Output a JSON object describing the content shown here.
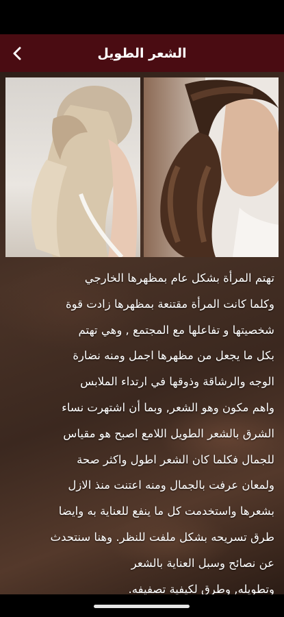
{
  "header": {
    "title": "الشعر الطويل",
    "back_icon": "chevron-left-icon",
    "background_color": "#4a0c12"
  },
  "hero": {
    "images": [
      "blonde-ponytail-photo",
      "braided-brunette-ponytail-photo"
    ]
  },
  "article": {
    "lines": [
      "تهتم المرأة بشكل عام بمظهرها الخارجي",
      "وكلما كانت المرأة مقتنعة بمظهرها زادت قوة",
      "شخصيتها و تفاعلها مع المجتمع , وهي تهتم",
      "بكل ما يجعل من مظهرها اجمل ومنه نضارة",
      "الوجه والرشاقة وذوقها في ارتداء الملابس",
      "واهم مكون وهو الشعر, وبما أن اشتهرت نساء",
      "الشرق بالشعر الطويل اللامع اصبح هو مقياس",
      "للجمال فكلما كان الشعر اطول واكثر صحة",
      "ولمعان عرفت بالجمال ومنه اعتنت منذ الازل",
      "بشعرها واستخدمت كل ما ينفع للعناية به وايضا",
      "طرق تسريحه بشكل ملفت للنظر. وهنا سنتحدث",
      "عن نصائح وسبل العناية بالشعر",
      "وتطويله, وطرق لكيفية تصفيفه."
    ]
  }
}
